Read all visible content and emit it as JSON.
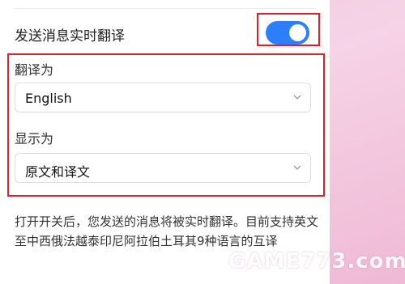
{
  "settings": {
    "realtime_translate": {
      "label": "发送消息实时翻译",
      "enabled": true
    },
    "translate_to": {
      "label": "翻译为",
      "value": "English"
    },
    "display_as": {
      "label": "显示为",
      "value": "原文和译文"
    },
    "help_text": "打开开关后，您发送的消息将被实时翻译。目前支持英文至中西俄法越泰印尼阿拉伯土耳其9种语言的互译"
  },
  "watermark": "GAME773.com",
  "colors": {
    "toggle_on": "#2d7ff9",
    "highlight_border": "#d9232e",
    "background_pink": "#f2c9df"
  },
  "icons": {
    "select_arrow": "chevron-down-icon"
  }
}
